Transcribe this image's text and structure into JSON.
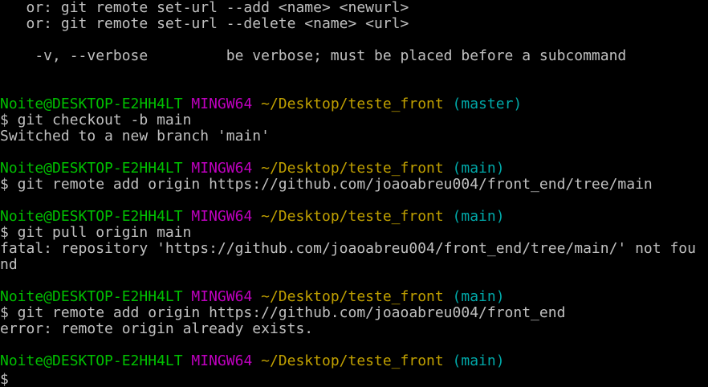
{
  "terminal": {
    "colors": {
      "background": "#000000",
      "text": "#c0c0c0",
      "user_host": "#00c000",
      "system": "#c000c0",
      "path": "#c0a000",
      "branch": "#00a8a8"
    },
    "usage_lines": [
      "   or: git remote set-url --add <name> <newurl>",
      "   or: git remote set-url --delete <name> <url>",
      "",
      "    -v, --verbose         be verbose; must be placed before a subcommand"
    ],
    "prompt": {
      "user_host": "Noite@DESKTOP-E2HH4LT",
      "system": "MINGW64",
      "path": "~/Desktop/teste_front"
    },
    "blocks": [
      {
        "branch": "(master)",
        "command": "$ git checkout -b main",
        "output": [
          "Switched to a new branch 'main'"
        ]
      },
      {
        "branch": "(main)",
        "command": "$ git remote add origin https://github.com/joaoabreu004/front_end/tree/main",
        "output": []
      },
      {
        "branch": "(main)",
        "command": "$ git pull origin main",
        "output": [
          "fatal: repository 'https://github.com/joaoabreu004/front_end/tree/main/' not fou",
          "nd"
        ]
      },
      {
        "branch": "(main)",
        "command": "$ git remote add origin https://github.com/joaoabreu004/front_end",
        "output": [
          "error: remote origin already exists."
        ]
      },
      {
        "branch": "(main)",
        "command": "$",
        "output": []
      }
    ]
  }
}
